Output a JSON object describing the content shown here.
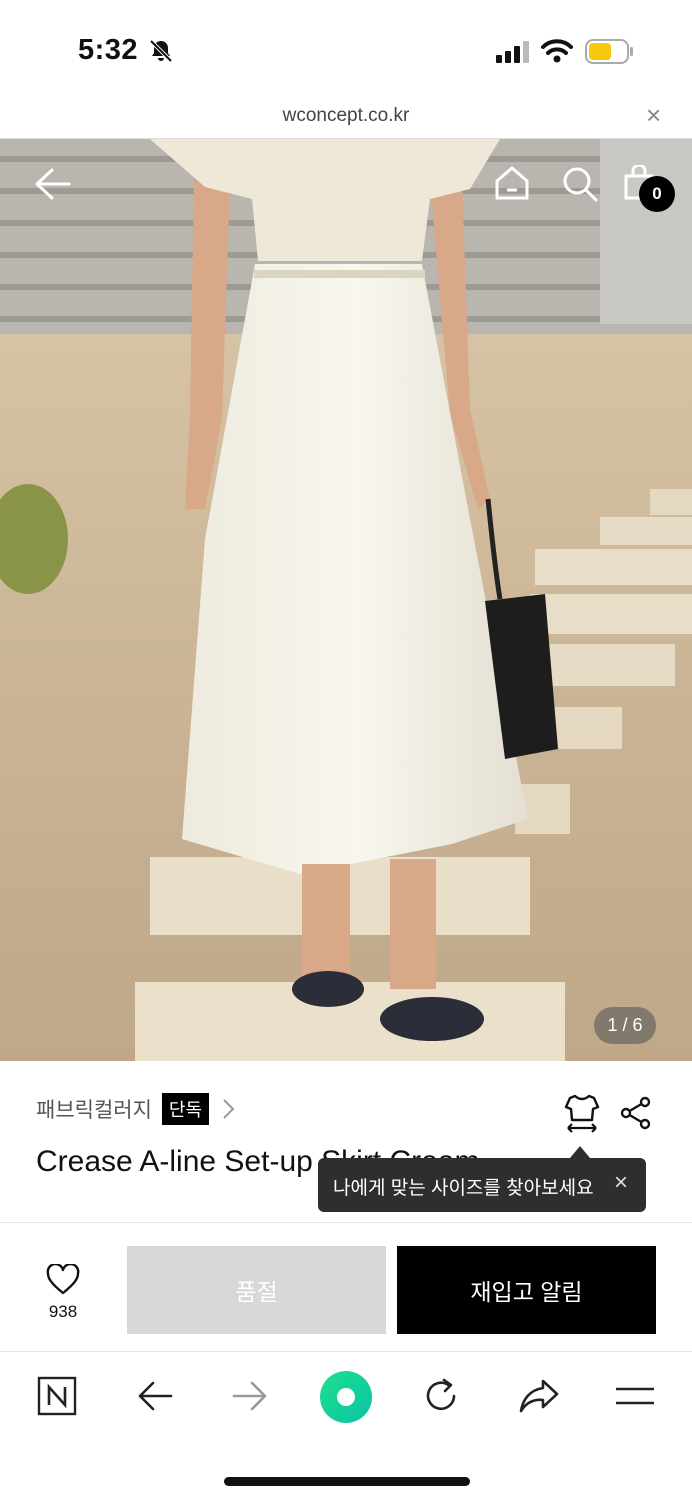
{
  "status_bar": {
    "time": "5:32",
    "icons": [
      "bell-slash-icon",
      "signal-icon",
      "wifi-icon",
      "battery-icon"
    ]
  },
  "browser": {
    "url": "wconcept.co.kr",
    "close_symbol": "×"
  },
  "hero": {
    "cart_count": "0",
    "image_counter": "1 / 6",
    "icons": [
      "back-arrow-icon",
      "home-icon",
      "search-icon",
      "shopping-bag-icon"
    ]
  },
  "product": {
    "brand": "패브릭컬러지",
    "exclusive_badge": "단독",
    "title": "Crease A-line Set-up Skirt Cream",
    "size_tooltip": "나에게 맞는 사이즈를 찾아보세요",
    "tooltip_close": "×"
  },
  "buy_bar": {
    "like_count": "938",
    "soldout_label": "품절",
    "restock_label": "재입고 알림"
  },
  "browser_toolbar": {
    "icons": [
      "naver-n-icon",
      "back-icon",
      "forward-icon",
      "green-dot-icon",
      "reload-icon",
      "share-icon",
      "menu-icon"
    ]
  },
  "colors": {
    "accent_green": "#14d37e",
    "battery_yellow": "#f6c90e",
    "button_black": "#000000",
    "button_disabled": "#d8d8d8"
  }
}
